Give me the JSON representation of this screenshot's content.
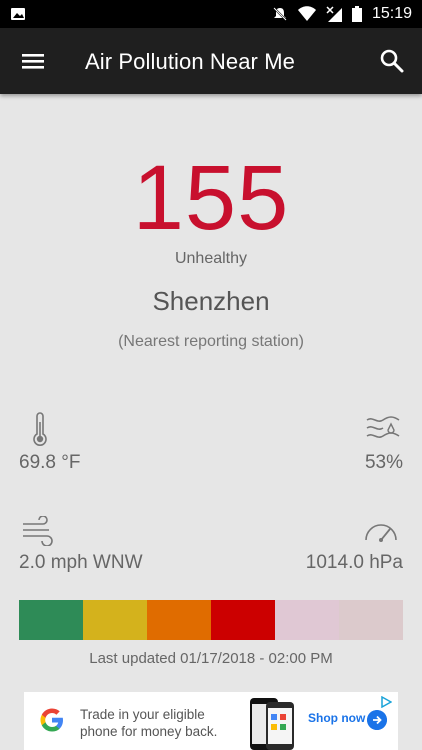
{
  "status_bar": {
    "time": "15:19",
    "icons": [
      "image-icon",
      "mute-icon",
      "wifi-icon",
      "no-signal-icon",
      "battery-icon"
    ]
  },
  "app_bar": {
    "title": "Air Pollution Near Me",
    "menu_icon": "menu-icon",
    "search_icon": "search-icon"
  },
  "aqi": {
    "value": "155",
    "level": "Unhealthy",
    "color": "#c8102e"
  },
  "location": {
    "city": "Shenzhen",
    "note": "(Nearest reporting station)"
  },
  "metrics": {
    "temperature": "69.8 °F",
    "humidity": "53%",
    "wind": "2.0 mph WNW",
    "pressure": "1014.0 hPa"
  },
  "scale_colors": [
    "#2e8b57",
    "#d4b21c",
    "#e06c00",
    "#cc0000",
    "#e0c8d4",
    "#dccacc"
  ],
  "updated": "Last updated 01/17/2018 - 02:00 PM",
  "ad": {
    "text": "Trade in your eligible phone for money back.",
    "cta": "Shop now"
  }
}
